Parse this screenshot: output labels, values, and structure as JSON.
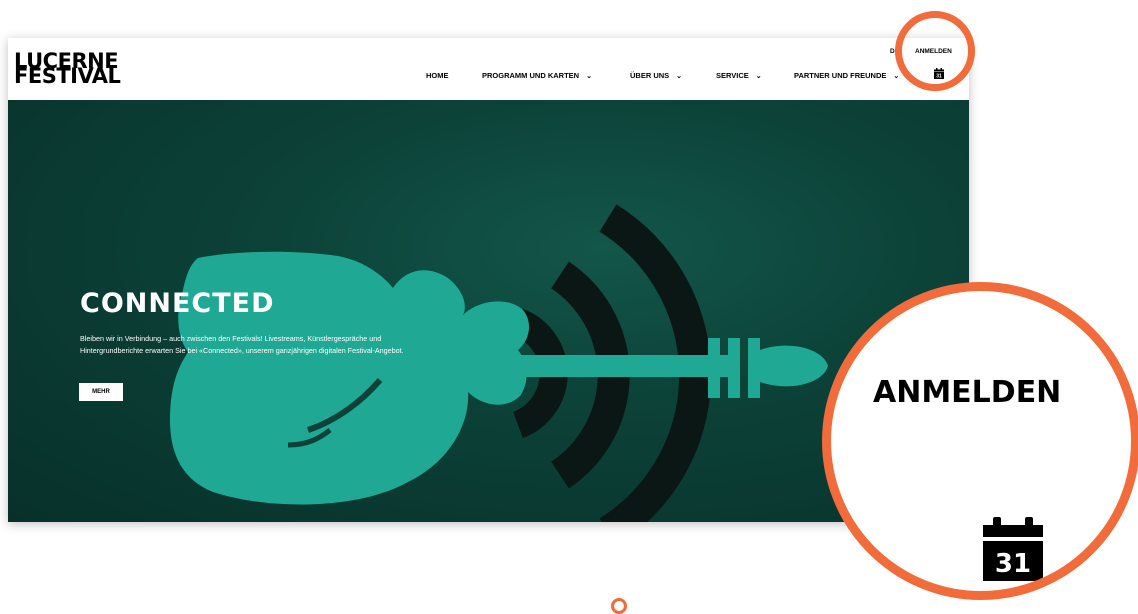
{
  "logo": {
    "line1": "LUCERNE",
    "line2": "FESTIVAL"
  },
  "nav": {
    "items": [
      {
        "label": "HOME",
        "chevron": ""
      },
      {
        "label": "PROGRAMM UND KARTEN",
        "chevron": "⌄"
      },
      {
        "label": "ÜBER UNS",
        "chevron": "⌄"
      },
      {
        "label": "SERVICE",
        "chevron": "⌄"
      },
      {
        "label": "PARTNER UND FREUNDE",
        "chevron": "⌄"
      }
    ]
  },
  "header": {
    "language": "DE",
    "login": "ANMELDEN",
    "calendar_day": "31"
  },
  "hero": {
    "title": "CONNECTED",
    "text": "Bleiben wir in Verbindung – auch zwischen den Festivals! Livestreams, Künstlergespräche und Hintergrundberichte erwarten Sie bei «Connected», unserem ganzjährigen digitalen Festival-Angebot.",
    "button": "MEHR"
  },
  "zoom": {
    "login": "ANMELDEN",
    "calendar_day": "31"
  },
  "colors": {
    "accent": "#f26b3a",
    "hero_bg": "#0c4238",
    "violin": "#1fa894"
  }
}
